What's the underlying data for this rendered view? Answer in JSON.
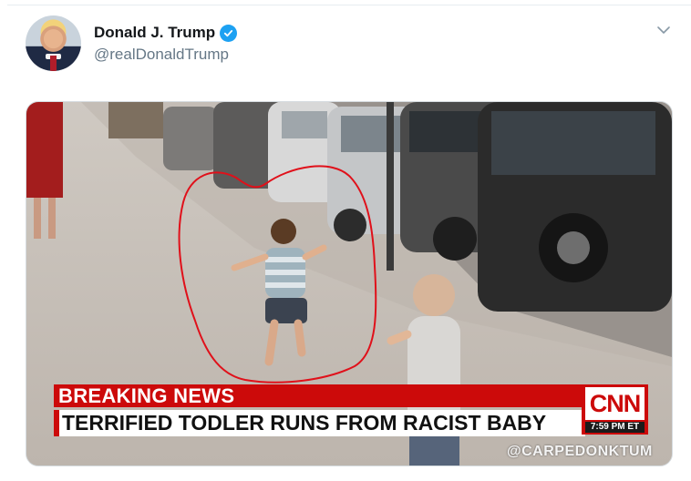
{
  "tweet": {
    "author": {
      "display_name": "Donald J. Trump",
      "handle": "@realDonaldTrump",
      "verified": true,
      "avatar_icon": "profile-photo"
    },
    "menu_icon": "chevron-down-icon"
  },
  "media": {
    "breaking_label": "BREAKING NEWS",
    "headline": "TERRIFIED TODLER RUNS FROM RACIST BABY",
    "network_logo": "CNN",
    "timestamp": "7:59 PM ET",
    "watermark": "@CARPEDONKTUM",
    "annotation": "red hand-drawn circle around running toddler"
  },
  "colors": {
    "verified_blue": "#1da1f2",
    "breaking_red": "#cc0a0a",
    "handle_gray": "#657786",
    "annotation_red": "#e0101a"
  }
}
